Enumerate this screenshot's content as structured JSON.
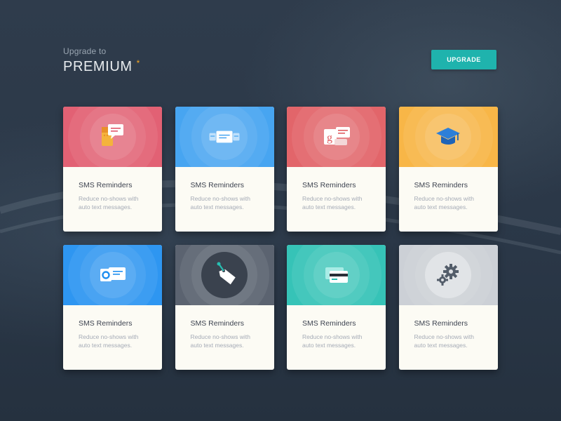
{
  "header": {
    "subtitle": "Upgrade to",
    "title": "PREMIUM",
    "star": "*",
    "upgrade_label": "UPGRADE"
  },
  "colors": {
    "accent": "#1fb3ad",
    "star": "#f5a623",
    "background": "#2e3b4b"
  },
  "cards": [
    {
      "title": "SMS Reminders",
      "desc": "Reduce no-shows with auto text messages.",
      "icon": "calendar-message-icon",
      "color": "#e0566a"
    },
    {
      "title": "SMS Reminders",
      "desc": "Reduce no-shows with auto text messages.",
      "icon": "messages-icon",
      "color": "#3a9ff0"
    },
    {
      "title": "SMS Reminders",
      "desc": "Reduce no-shows with auto text messages.",
      "icon": "google-message-icon",
      "color": "#e05a5f"
    },
    {
      "title": "SMS Reminders",
      "desc": "Reduce no-shows with auto text messages.",
      "icon": "graduation-cap-icon",
      "color": "#f8b13a"
    },
    {
      "title": "SMS Reminders",
      "desc": "Reduce no-shows with auto text messages.",
      "icon": "outlook-message-icon",
      "color": "#1f8ff0"
    },
    {
      "title": "SMS Reminders",
      "desc": "Reduce no-shows with auto text messages.",
      "icon": "price-tag-icon",
      "color": "#4f5866"
    },
    {
      "title": "SMS Reminders",
      "desc": "Reduce no-shows with auto text messages.",
      "icon": "credit-card-icon",
      "color": "#27bfb2"
    },
    {
      "title": "SMS Reminders",
      "desc": "Reduce no-shows with auto text messages.",
      "icon": "gears-icon",
      "color": "#c9cdd3"
    }
  ]
}
